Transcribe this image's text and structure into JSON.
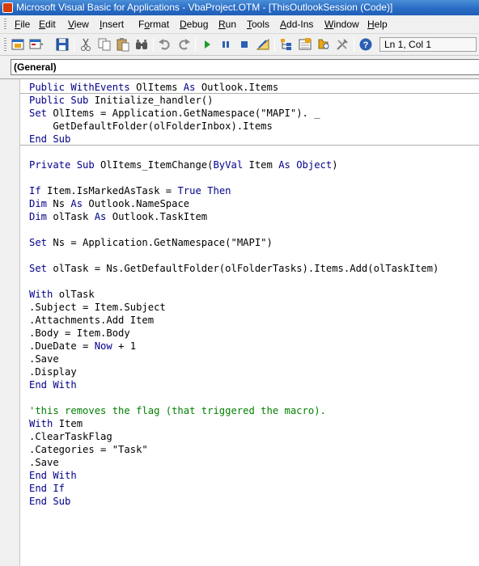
{
  "window": {
    "title": "Microsoft Visual Basic for Applications - VbaProject.OTM - [ThisOutlookSession (Code)]"
  },
  "menu": [
    {
      "accel": "F",
      "rest": "ile"
    },
    {
      "accel": "E",
      "rest": "dit"
    },
    {
      "accel": "V",
      "rest": "iew"
    },
    {
      "accel": "I",
      "rest": "nsert"
    },
    {
      "accel": "",
      "pre": "F",
      "accel2": "o",
      "rest": "rmat"
    },
    {
      "accel": "D",
      "rest": "ebug"
    },
    {
      "accel": "R",
      "rest": "un"
    },
    {
      "accel": "T",
      "rest": "ools"
    },
    {
      "accel": "A",
      "rest": "dd-Ins"
    },
    {
      "accel": "W",
      "rest": "indow"
    },
    {
      "accel": "H",
      "rest": "elp"
    }
  ],
  "toolbar": {
    "position": "Ln 1, Col 1"
  },
  "object_list": {
    "selected": "(General)"
  },
  "code": [
    {
      "tokens": [
        [
          "k",
          "Public WithEvents"
        ],
        [
          "n",
          " OlItems "
        ],
        [
          "k",
          "As"
        ],
        [
          "n",
          " Outlook.Items"
        ]
      ],
      "sep": true
    },
    {
      "tokens": [
        [
          "k",
          "Public Sub"
        ],
        [
          "n",
          " Initialize_handler()"
        ]
      ]
    },
    {
      "tokens": [
        [
          "k",
          "Set"
        ],
        [
          "n",
          " OlItems = Application.GetNamespace(\"MAPI\"). _"
        ]
      ]
    },
    {
      "tokens": [
        [
          "n",
          "    GetDefaultFolder(olFolderInbox).Items"
        ]
      ]
    },
    {
      "tokens": [
        [
          "k",
          "End Sub"
        ]
      ],
      "sep": true
    },
    {
      "tokens": []
    },
    {
      "tokens": [
        [
          "k",
          "Private Sub"
        ],
        [
          "n",
          " OlItems_ItemChange("
        ],
        [
          "k",
          "ByVal"
        ],
        [
          "n",
          " Item "
        ],
        [
          "k",
          "As Object"
        ],
        [
          "n",
          ")"
        ]
      ]
    },
    {
      "tokens": []
    },
    {
      "tokens": [
        [
          "k",
          "If"
        ],
        [
          "n",
          " Item.IsMarkedAsTask = "
        ],
        [
          "k",
          "True Then"
        ]
      ]
    },
    {
      "tokens": [
        [
          "k",
          "Dim"
        ],
        [
          "n",
          " Ns "
        ],
        [
          "k",
          "As"
        ],
        [
          "n",
          " Outlook.NameSpace"
        ]
      ]
    },
    {
      "tokens": [
        [
          "k",
          "Dim"
        ],
        [
          "n",
          " olTask "
        ],
        [
          "k",
          "As"
        ],
        [
          "n",
          " Outlook.TaskItem"
        ]
      ]
    },
    {
      "tokens": []
    },
    {
      "tokens": [
        [
          "k",
          "Set"
        ],
        [
          "n",
          " Ns = Application.GetNamespace(\"MAPI\")"
        ]
      ]
    },
    {
      "tokens": []
    },
    {
      "tokens": [
        [
          "k",
          "Set"
        ],
        [
          "n",
          " olTask = Ns.GetDefaultFolder(olFolderTasks).Items.Add(olTaskItem)"
        ]
      ]
    },
    {
      "tokens": []
    },
    {
      "tokens": [
        [
          "k",
          "With"
        ],
        [
          "n",
          " olTask"
        ]
      ]
    },
    {
      "tokens": [
        [
          "n",
          ".Subject = Item.Subject"
        ]
      ]
    },
    {
      "tokens": [
        [
          "n",
          ".Attachments.Add Item"
        ]
      ]
    },
    {
      "tokens": [
        [
          "n",
          ".Body = Item.Body"
        ]
      ]
    },
    {
      "tokens": [
        [
          "n",
          ".DueDate = "
        ],
        [
          "k",
          "Now"
        ],
        [
          "n",
          " + 1"
        ]
      ]
    },
    {
      "tokens": [
        [
          "n",
          ".Save"
        ]
      ]
    },
    {
      "tokens": [
        [
          "n",
          ".Display"
        ]
      ]
    },
    {
      "tokens": [
        [
          "k",
          "End With"
        ]
      ]
    },
    {
      "tokens": []
    },
    {
      "tokens": [
        [
          "c",
          "'this removes the flag (that triggered the macro)."
        ]
      ]
    },
    {
      "tokens": [
        [
          "k",
          "With"
        ],
        [
          "n",
          " Item"
        ]
      ]
    },
    {
      "tokens": [
        [
          "n",
          ".ClearTaskFlag"
        ]
      ]
    },
    {
      "tokens": [
        [
          "n",
          ".Categories = \"Task\""
        ]
      ]
    },
    {
      "tokens": [
        [
          "n",
          ".Save"
        ]
      ]
    },
    {
      "tokens": [
        [
          "k",
          "End With"
        ]
      ]
    },
    {
      "tokens": [
        [
          "k",
          "End If"
        ]
      ]
    },
    {
      "tokens": [
        [
          "k",
          "End Sub"
        ]
      ]
    }
  ],
  "colors": {
    "keyword": "#00008b",
    "comment": "#008000",
    "title_bar": "#2a6cc4"
  }
}
